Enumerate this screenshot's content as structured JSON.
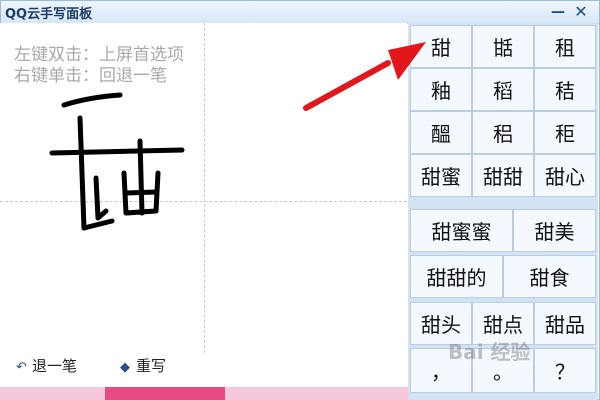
{
  "window": {
    "title": "QQ云手写面板",
    "min_glyph": "—",
    "close_glyph": "✕"
  },
  "hints": {
    "line1": "左键双击：上屏首选项",
    "line2": "右键单击：回退一笔"
  },
  "buttons": {
    "undo": {
      "label": "退一笔",
      "icon": "undo-arrow-icon",
      "glyph": "↶"
    },
    "rewrite": {
      "label": "重写",
      "icon": "eraser-icon",
      "glyph": "◆"
    }
  },
  "candidates": [
    "甜",
    "甛",
    "租",
    "釉",
    "稻",
    "秸",
    "醞",
    "稆",
    "秬",
    "甜蜜",
    "甜甜",
    "甜心",
    "甜蜜蜜",
    "甜美",
    "甜甜的",
    "甜食",
    "甜头",
    "甜点",
    "甜品",
    "，",
    "。",
    "？"
  ],
  "watermark": "Bai 经验",
  "colors": {
    "arrow": "#e3171b",
    "title_text": "#1c3c66",
    "panel_bg": "#d4e3f3"
  }
}
